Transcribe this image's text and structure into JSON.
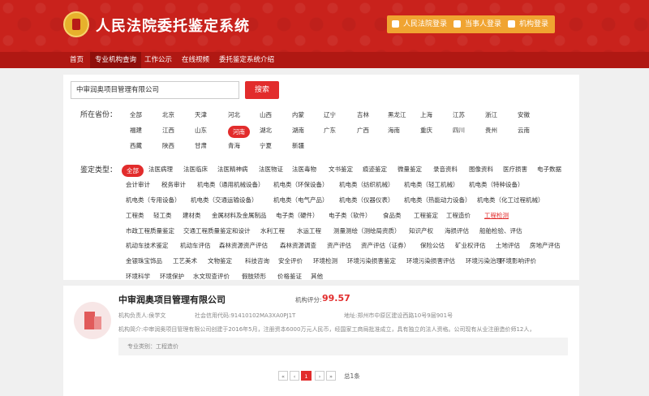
{
  "header": {
    "title": "人民法院委托鉴定系统",
    "buttons": [
      "人民法院登录",
      "当事人登录",
      "机构登录"
    ]
  },
  "nav": [
    "首页",
    "专业机构查询",
    "工作公示",
    "在线视频",
    "委托鉴定系统介绍"
  ],
  "search": {
    "value": "中审润奥项目管理有限公司",
    "button": "搜索"
  },
  "province": {
    "label": "所在省份：",
    "items": [
      "全部",
      "北京",
      "天津",
      "河北",
      "山西",
      "内蒙",
      "辽宁",
      "吉林",
      "黑龙江",
      "上海",
      "江苏",
      "浙江",
      "安徽",
      "福建",
      "江西",
      "山东",
      "河南",
      "湖北",
      "湖南",
      "广东",
      "广西",
      "海南",
      "重庆",
      "四川",
      "贵州",
      "云南",
      "西藏",
      "陕西",
      "甘肃",
      "青海",
      "宁夏",
      "新疆"
    ],
    "selected": "河南"
  },
  "type": {
    "label": "鉴定类型：",
    "items": [
      "全部",
      "法医病理",
      "法医临床",
      "法医精神病",
      "法医物证",
      "法医毒物",
      "文书鉴定",
      "痕迹鉴定",
      "微量鉴定",
      "录音资料",
      "图像资料",
      "医疗损害",
      "电子数据",
      "会计审计",
      "税务审计",
      "机电类（通用机械设备）",
      "机电类（环保设备）",
      "机电类（纺织机械）",
      "机电类（轻工机械）",
      "机电类（特种设备）",
      "机电类（专用设备）",
      "机电类（交通运输设备）",
      "机电类（电气产品）",
      "机电类（仪器仪表）",
      "机电类（热能动力设备）",
      "机电类（化工过程机械）",
      "工程类",
      "轻工类",
      "建材类",
      "金属材料及金属制品",
      "电子类（硬件）",
      "电子类（软件）",
      "食品类",
      "工程鉴定",
      "工程造价",
      "工程检测",
      "市政工程质量鉴定",
      "交通工程质量鉴定和设计",
      "水利工程",
      "水运工程",
      "测量测绘（测绘局资质）",
      "知识产权",
      "海损评估",
      "船舶检验、评估",
      "机动车技术鉴定",
      "机动车评估",
      "森林资源资产评估",
      "森林资源调查",
      "资产评估",
      "资产评估（证券）",
      "保险公估",
      "矿业权评估",
      "土地评估",
      "房地产评估",
      "金银珠宝饰品",
      "工艺美术",
      "文物鉴定",
      "科技咨询",
      "安全评价",
      "环境检测",
      "环境污染损害鉴定",
      "环境污染损害评估",
      "环境污染治理",
      "环境影响评价",
      "环境科学",
      "环境保护",
      "水文现查评价",
      "假肢矫形",
      "价格鉴证",
      "其他"
    ],
    "selected": "全部",
    "highlighted": "工程检测"
  },
  "result": {
    "name": "中审润奥项目管理有限公司",
    "rating_label": "机构评分:",
    "rating": "99.57",
    "leader": "机构负责人:侯学文",
    "credit_code": "社会信用代码:91410102MA3XA0PJ1T",
    "address": "地址:郑州市中原区建设西路10号9层901号",
    "intro": "机构简介:中审润奥项目管理有限公司创建于2016年5月，注册资本6000万元人民币，经国家工商局批准成立，具有独立的法人资格。公司现有从业注册造价师12人，",
    "category": "专业类别：工程造价"
  },
  "pagination": {
    "first": "«",
    "prev": "‹",
    "current": "1",
    "next": "›",
    "last": "»",
    "total": "总1条"
  }
}
